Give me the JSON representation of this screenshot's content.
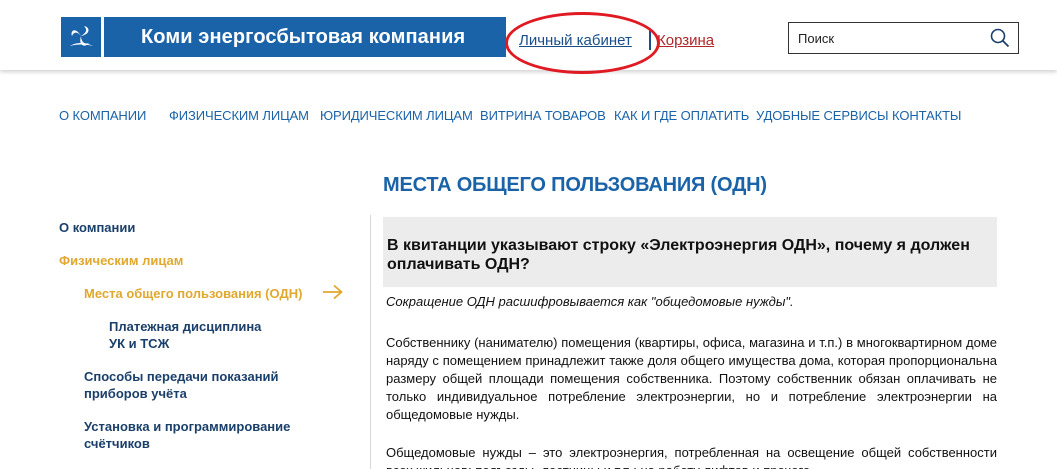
{
  "header": {
    "company_name": "Коми энергосбытовая компания",
    "cabinet_link": "Личный кабинет",
    "cart_link": "Корзина",
    "search_placeholder": "Поиск",
    "logo_icon": "company-logo",
    "search_icon": "search-icon",
    "brand_color": "#1a63a8",
    "highlight_color": "#e01a22"
  },
  "nav": {
    "items": [
      {
        "label": "О КОМПАНИИ"
      },
      {
        "label": "ФИЗИЧЕСКИМ ЛИЦАМ"
      },
      {
        "label": "ЮРИДИЧЕСКИМ ЛИЦАМ"
      },
      {
        "label": "ВИТРИНА ТОВАРОВ"
      },
      {
        "label": "КАК И ГДЕ ОПЛАТИТЬ"
      },
      {
        "label": "УДОБНЫЕ СЕРВИСЫ"
      },
      {
        "label": "КОНТАКТЫ"
      }
    ]
  },
  "page": {
    "title": "МЕСТА ОБЩЕГО ПОЛЬЗОВАНИЯ (ОДН)"
  },
  "sidebar": {
    "items": [
      {
        "label": "О компании"
      },
      {
        "label": "Физическим лицам"
      },
      {
        "label": "Места общего пользования (ОДН)"
      },
      {
        "label_line1": "Платежная дисциплина",
        "label_line2": "УК и ТСЖ"
      },
      {
        "label_line1": "Способы передачи показаний",
        "label_line2": "приборов учёта"
      },
      {
        "label_line1": "Установка и программирование",
        "label_line2": "счётчиков"
      }
    ],
    "active_color": "#e0a82e",
    "arrow_icon": "arrow-right-icon"
  },
  "content": {
    "question": "В квитанции указывают строку «Электроэнергия ОДН», почему я должен оплачивать ОДН?",
    "intro": "Сокращение ОДН расшифровывается как \"общедомовые нужды\".",
    "paragraph1": "Собственнику (нанимателю) помещения (квартиры, офиса, магазина и т.п.) в многоквартирном доме наряду с помещением принадлежит также доля общего имущества дома, которая пропорциональна размеру общей площади помещения собственника. Поэтому собственник обязан оплачивать не только индивидуальное потребление электроэнергии, но и потребление электроэнергии на общедомовые нужды.",
    "paragraph2": "Общедомовые нужды – это электроэнергия, потребленная на освещение общей собственности всех жильцов: подъезды, лестницы и т.п.; на работу лифтов и прочего"
  }
}
